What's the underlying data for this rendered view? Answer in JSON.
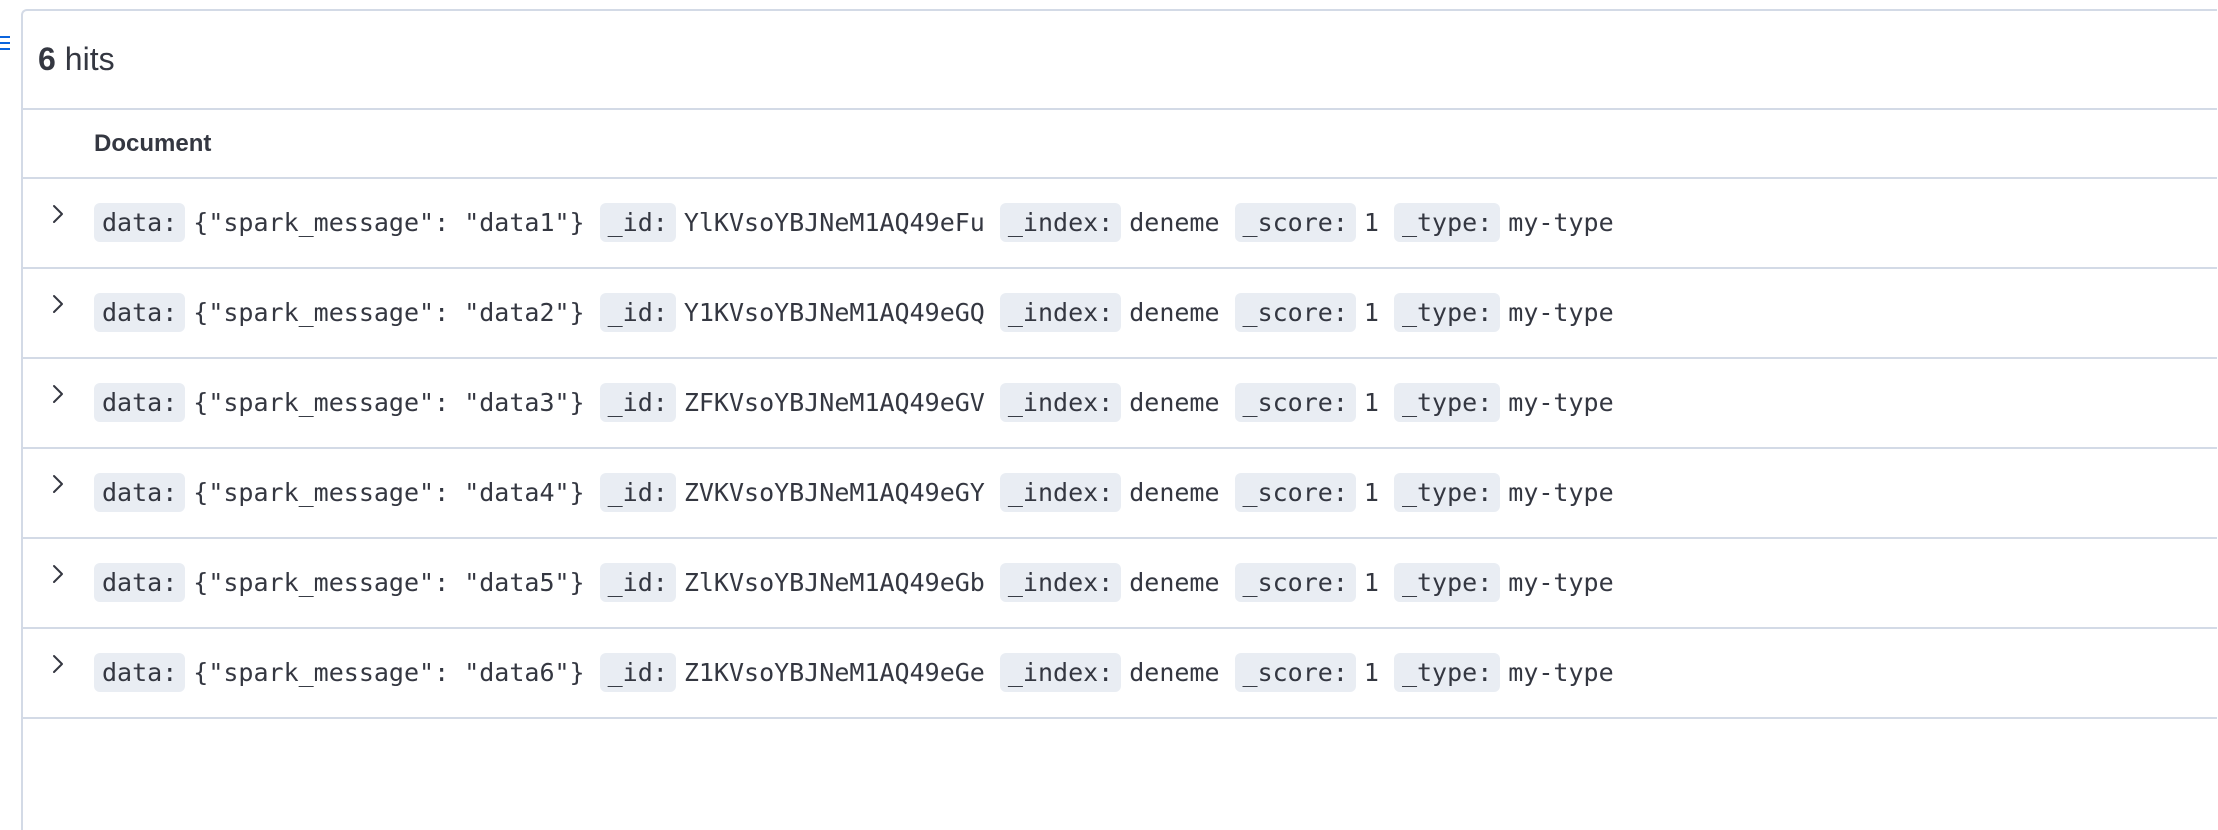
{
  "hits": {
    "count": "6",
    "label": "hits"
  },
  "table": {
    "column_header": "Document"
  },
  "rows": [
    {
      "data_key": "data:",
      "data_val": "{\"spark_message\": \"data1\"}",
      "id_key": "_id:",
      "id_val": "YlKVsoYBJNeM1AQ49eFu",
      "index_key": "_index:",
      "index_val": "deneme",
      "score_key": "_score:",
      "score_val": "1",
      "type_key": "_type:",
      "type_val": "my-type"
    },
    {
      "data_key": "data:",
      "data_val": "{\"spark_message\": \"data2\"}",
      "id_key": "_id:",
      "id_val": "Y1KVsoYBJNeM1AQ49eGQ",
      "index_key": "_index:",
      "index_val": "deneme",
      "score_key": "_score:",
      "score_val": "1",
      "type_key": "_type:",
      "type_val": "my-type"
    },
    {
      "data_key": "data:",
      "data_val": "{\"spark_message\": \"data3\"}",
      "id_key": "_id:",
      "id_val": "ZFKVsoYBJNeM1AQ49eGV",
      "index_key": "_index:",
      "index_val": "deneme",
      "score_key": "_score:",
      "score_val": "1",
      "type_key": "_type:",
      "type_val": "my-type"
    },
    {
      "data_key": "data:",
      "data_val": "{\"spark_message\": \"data4\"}",
      "id_key": "_id:",
      "id_val": "ZVKVsoYBJNeM1AQ49eGY",
      "index_key": "_index:",
      "index_val": "deneme",
      "score_key": "_score:",
      "score_val": "1",
      "type_key": "_type:",
      "type_val": "my-type"
    },
    {
      "data_key": "data:",
      "data_val": "{\"spark_message\": \"data5\"}",
      "id_key": "_id:",
      "id_val": "ZlKVsoYBJNeM1AQ49eGb",
      "index_key": "_index:",
      "index_val": "deneme",
      "score_key": "_score:",
      "score_val": "1",
      "type_key": "_type:",
      "type_val": "my-type"
    },
    {
      "data_key": "data:",
      "data_val": "{\"spark_message\": \"data6\"}",
      "id_key": "_id:",
      "id_val": "Z1KVsoYBJNeM1AQ49eGe",
      "index_key": "_index:",
      "index_val": "deneme",
      "score_key": "_score:",
      "score_val": "1",
      "type_key": "_type:",
      "type_val": "my-type"
    }
  ],
  "icons": {
    "sidebar_toggle": "list-icon",
    "expand": "chevron-right-icon"
  },
  "colors": {
    "accent": "#0b64dd",
    "border": "#d3dae6",
    "key_badge": "#e9edf3",
    "text": "#343741"
  }
}
